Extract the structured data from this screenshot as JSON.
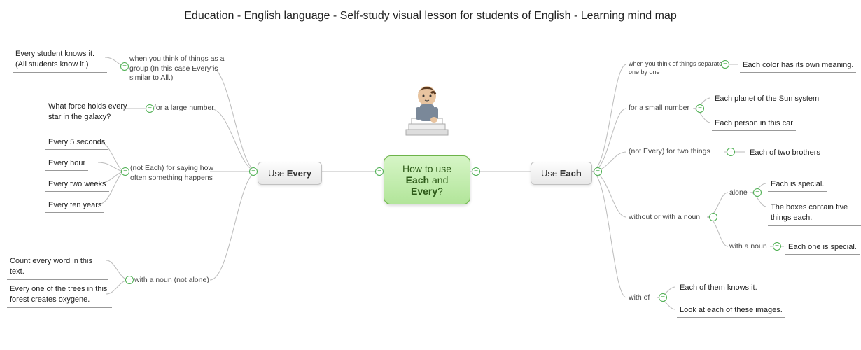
{
  "title": "Education - English language - Self-study visual lesson for students of English - Learning mind map",
  "center": {
    "line1": "How to use",
    "line2_strong1": "Each",
    "line2_mid": " and ",
    "line2_strong2": "Every",
    "line2_end": "?"
  },
  "left": {
    "label_pre": "Use ",
    "label_strong": "Every",
    "branches": [
      {
        "label": "when you think of things as a group (In this case Every is similar to All.)",
        "leaves": [
          "Every student knows it.\n(All students know it.)"
        ]
      },
      {
        "label": "for a large number",
        "leaves": [
          "What force holds every star in the galaxy?"
        ]
      },
      {
        "label": "(not Each) for saying how often something happens",
        "leaves": [
          "Every 5 seconds",
          "Every hour",
          "Every two weeks",
          "Every ten years"
        ]
      },
      {
        "label": "with a noun (not alone)",
        "leaves": [
          "Count every word in this text.",
          "Every one of the trees in this forest creates oxygene."
        ]
      }
    ]
  },
  "right": {
    "label_pre": "Use ",
    "label_strong": "Each",
    "branches": [
      {
        "label": "when you think of things separately, one by one",
        "leaves": [
          "Each color has its own meaning."
        ]
      },
      {
        "label": "for a small number",
        "leaves": [
          "Each planet of the Sun system",
          "Each person in this car"
        ]
      },
      {
        "label": "(not Every) for two things",
        "leaves": [
          "Each of two brothers"
        ]
      },
      {
        "label": "without or with a noun",
        "sub": [
          {
            "label": "alone",
            "leaves": [
              "Each is special.",
              "The boxes contain five things each."
            ]
          },
          {
            "label": "with a noun",
            "leaves": [
              "Each one is special."
            ]
          }
        ]
      },
      {
        "label": "with of",
        "leaves": [
          "Each of them knows it.",
          "Look at each of these images."
        ]
      }
    ]
  }
}
